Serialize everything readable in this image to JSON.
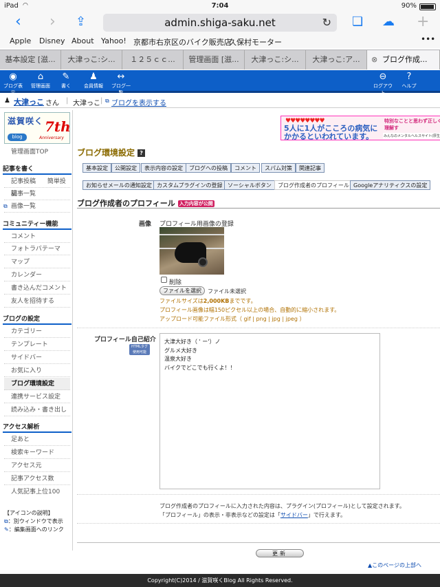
{
  "status": {
    "device": "iPad",
    "wifi": "wifi",
    "time": "7:04",
    "battery": "90%"
  },
  "browser": {
    "url": "admin.shiga-saku.net",
    "bookmarks": [
      "Apple",
      "Disney",
      "About",
      "Yahoo!",
      "京都市右京区のバイク販売店",
      "久保村モーター"
    ],
    "tabs": [
      "基本設定 [滋...",
      "大津っこ:シ...",
      "１２５ｃｃ...",
      "管理画面 [滋...",
      "大津っこ:シ...",
      "大津っこ:ア...",
      "ブログ作成..."
    ]
  },
  "nav": {
    "items": [
      "ブログ表示",
      "管理画面",
      "書く",
      "会員情報",
      "ブログ一覧"
    ],
    "right": [
      "ログアウト",
      "ヘルプ"
    ]
  },
  "user": {
    "name": "大津っこ",
    "suffix": "さん",
    "blog": "大津っこ",
    "view_blog": "ブログを表示する"
  },
  "logo": {
    "text": "滋賀咲く",
    "badge": "blog",
    "seven": "7th",
    "anniv": "Anniversary"
  },
  "sidebar": {
    "top": "管理画面TOP",
    "write_head": "記事を書く",
    "post": "記事投稿",
    "simple": "簡単投稿",
    "list": "記事一覧",
    "images": "画像一覧",
    "community_head": "コミュニティー機能",
    "community": [
      "コメント",
      "フォトラバテーマ",
      "マップ",
      "カレンダー",
      "書き込んだコメント",
      "友人を招待する"
    ],
    "settings_head": "ブログの設定",
    "settings": [
      "カテゴリー",
      "テンプレート",
      "サイドバー",
      "お気に入り",
      "ブログ環境設定",
      "連携サービス設定",
      "読み込み・書き出し"
    ],
    "access_head": "アクセス解析",
    "access": [
      "足あと",
      "検索キーワード",
      "アクセス元",
      "記事アクセス数",
      "人気記事上位100"
    ],
    "icon_help": "【アイコンの説明】",
    "icon_new": "：別ウィンドウで表示",
    "icon_edit": "：編集画面へのリンク"
  },
  "banner": {
    "hearts": "♥♥♥♥♥♥♥♥",
    "line1": "5人に1人がこころの病気に",
    "line2": "かかるといわれています。",
    "right": "特別なことと思わず正しく理解す",
    "right2": "みんなのメンタルヘルスサイト(厚生"
  },
  "page": {
    "title": "ブログ環境設定",
    "q": "?",
    "tabs1": [
      "基本設定",
      "公開設定",
      "表示内容の設定",
      "ブログへの投稿",
      "コメント",
      "スパム対策",
      "関連記事"
    ],
    "tabs2": [
      "お知らせメールの通知設定",
      "カスタムプラグインの登録",
      "ソーシャルボタン",
      "ブログ作成者のプロフィール",
      "Googleアナリティクスの設定"
    ],
    "section": "ブログ作成者のプロフィール",
    "section_badge": "入力内容が公開",
    "image_label": "画像",
    "image_reg": "プロフィール用画像の登録",
    "delete": "削除",
    "file_btn": "ファイルを選択",
    "file_none": "ファイル未選択",
    "size_note_a": "ファイルサイズは",
    "size_note_b": "2,000KB",
    "size_note_c": "までです。",
    "width_note": "プロフィール画像は幅150ピクセル以上の場合、自動的に縮小されます。",
    "format_note": "アップロード可能ファイル形式（ gif | png | jpg | jpeg ）",
    "intro_label": "プロフィール自己紹介",
    "html_tag": "HTMLタグ 使用可能",
    "intro_text": "大津大好き（ ' ー'）ノ\nグルメ大好き\n温泉大好き\nバイクでどこでも行くよ！！",
    "foot_note1": "ブログ作成者のプロフィールに入力された内容は、プラグイン(プロフィール)として設定されます。",
    "foot_note2a": "「プロフィール」の表示・非表示などの設定は「",
    "foot_note2b": "サイドバー",
    "foot_note2c": "」で行えます。",
    "update": "更新",
    "top_link": "▲このページの上部へ"
  },
  "footer": "Copyright(C)2014 / 滋賀咲くBlog All Rights Reserved."
}
